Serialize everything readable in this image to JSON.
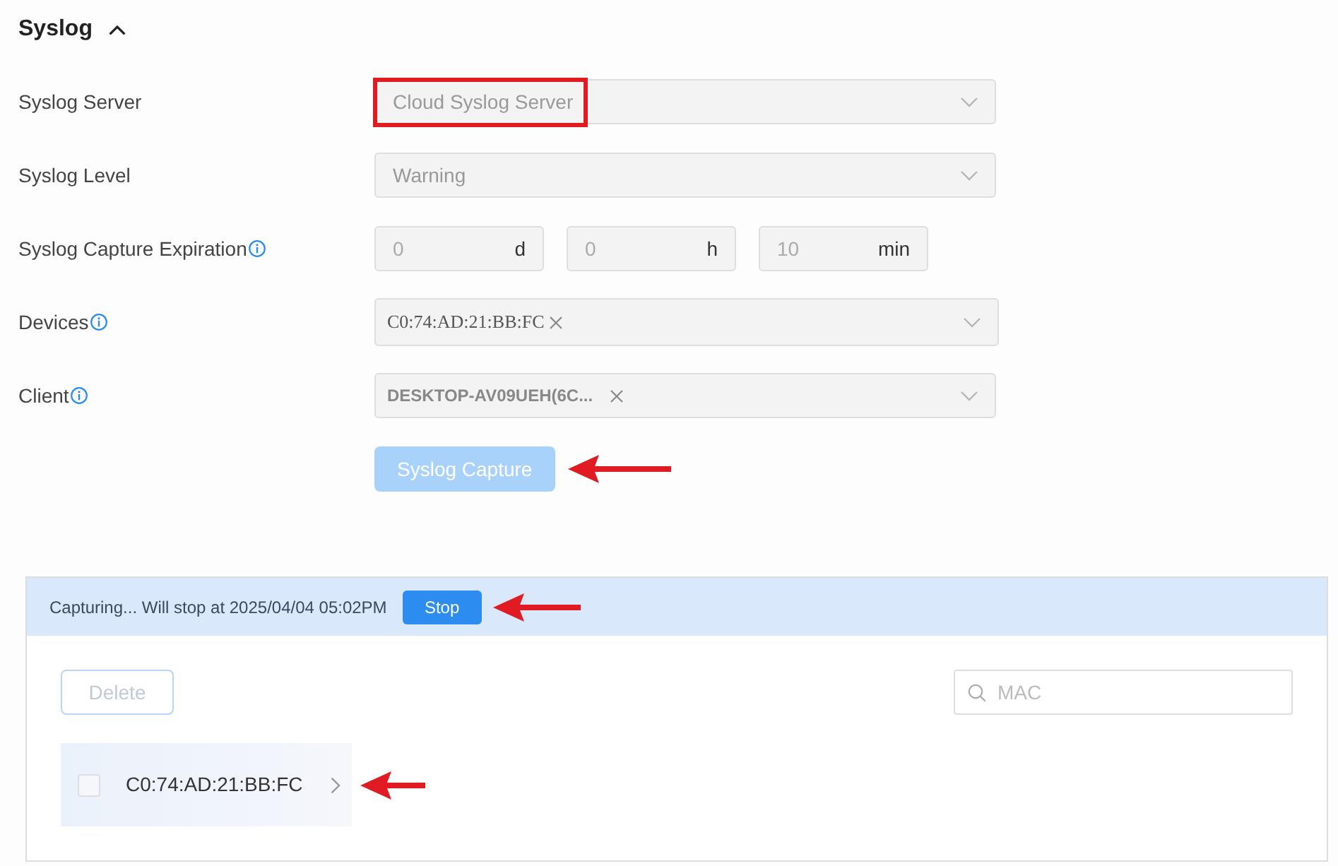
{
  "section": {
    "title": "Syslog",
    "expanded": true
  },
  "fields": [
    {
      "kind": "select",
      "label": "Syslog Server",
      "info": false,
      "value": "Cloud Syslog Server",
      "callout_frame": true
    },
    {
      "kind": "select",
      "label": "Syslog Level",
      "info": false,
      "value": "Warning",
      "callout_frame": false
    },
    {
      "kind": "duration",
      "label": "Syslog Capture Expiration",
      "info": true,
      "parts": [
        {
          "value": "0",
          "unit": "d"
        },
        {
          "value": "0",
          "unit": "h"
        },
        {
          "value": "10",
          "unit": "min"
        }
      ]
    },
    {
      "kind": "device_tags",
      "label": "Devices",
      "info": true,
      "tags": [
        "C0:74:AD:21:BB:FC"
      ]
    },
    {
      "kind": "client_tags",
      "label": "Client",
      "info": true,
      "tags": [
        "DESKTOP-AV09UEH(6C..."
      ]
    }
  ],
  "capture_button": {
    "label": "Syslog Capture",
    "disabled": true,
    "callout_arrow": true
  },
  "capture_panel": {
    "status": "Capturing... Will stop at 2025/04/04 05:02PM",
    "stop_button": {
      "label": "Stop",
      "disabled": false,
      "callout_arrow": true
    },
    "delete_button": {
      "label": "Delete",
      "disabled": true
    },
    "search": {
      "placeholder": "MAC"
    },
    "devices": [
      {
        "mac": "C0:74:AD:21:BB:FC",
        "checked": false,
        "callout_arrow": true
      }
    ]
  }
}
